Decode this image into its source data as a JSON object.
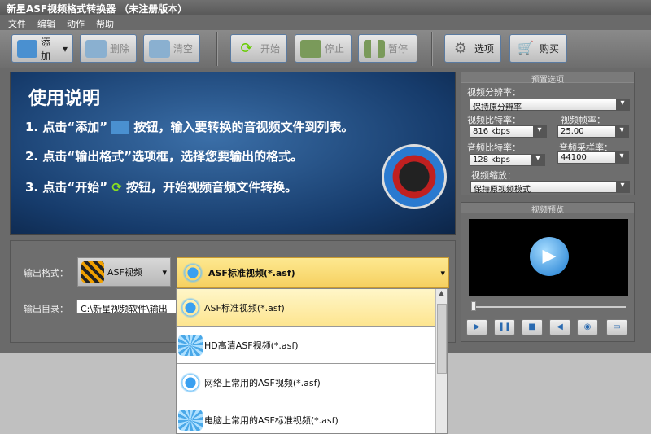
{
  "title": "新星ASF视频格式转换器 （未注册版本）",
  "menu": [
    "文件",
    "编辑",
    "动作",
    "帮助"
  ],
  "toolbar": {
    "add": "添加",
    "delete": "删除",
    "clear": "清空",
    "start": "开始",
    "stop": "停止",
    "pause": "暂停",
    "options": "选项",
    "buy": "购买"
  },
  "banner": {
    "heading": "使用说明",
    "steps": [
      "1. 点击“添加”",
      "按钮，输入要转换的音视频文件到列表。",
      "2. 点击“输出格式”选项框，选择您要输出的格式。",
      "3. 点击“开始”",
      "按钮，开始视频音频文件转换。"
    ]
  },
  "output": {
    "format_label": "输出格式：",
    "format_category": "ASF视频",
    "format_value": "ASF标准视频(*.asf)",
    "dir_label": "输出目录：",
    "dir_value": "C:\\新星视频软件\\输出"
  },
  "dropdown_items": [
    "ASF标准视频(*.asf)",
    "HD高清ASF视频(*.asf)",
    "网络上常用的ASF视频(*.asf)",
    "电脑上常用的ASF标准视频(*.asf)"
  ],
  "presets": {
    "header": "预置选项",
    "resolution_label": "视频分辨率：",
    "resolution": "保持原分辨率",
    "vbitrate_label": "视频比特率：",
    "vbitrate": "816 kbps",
    "fps_label": "视频帧率：",
    "fps": "25.00",
    "abitrate_label": "音频比特率：",
    "abitrate": "128 kbps",
    "samplerate_label": "音频采样率：",
    "samplerate": "44100",
    "scale_label": "视频缩放：",
    "scale": "保持原视频模式"
  },
  "preview": {
    "header": "视频预览"
  }
}
